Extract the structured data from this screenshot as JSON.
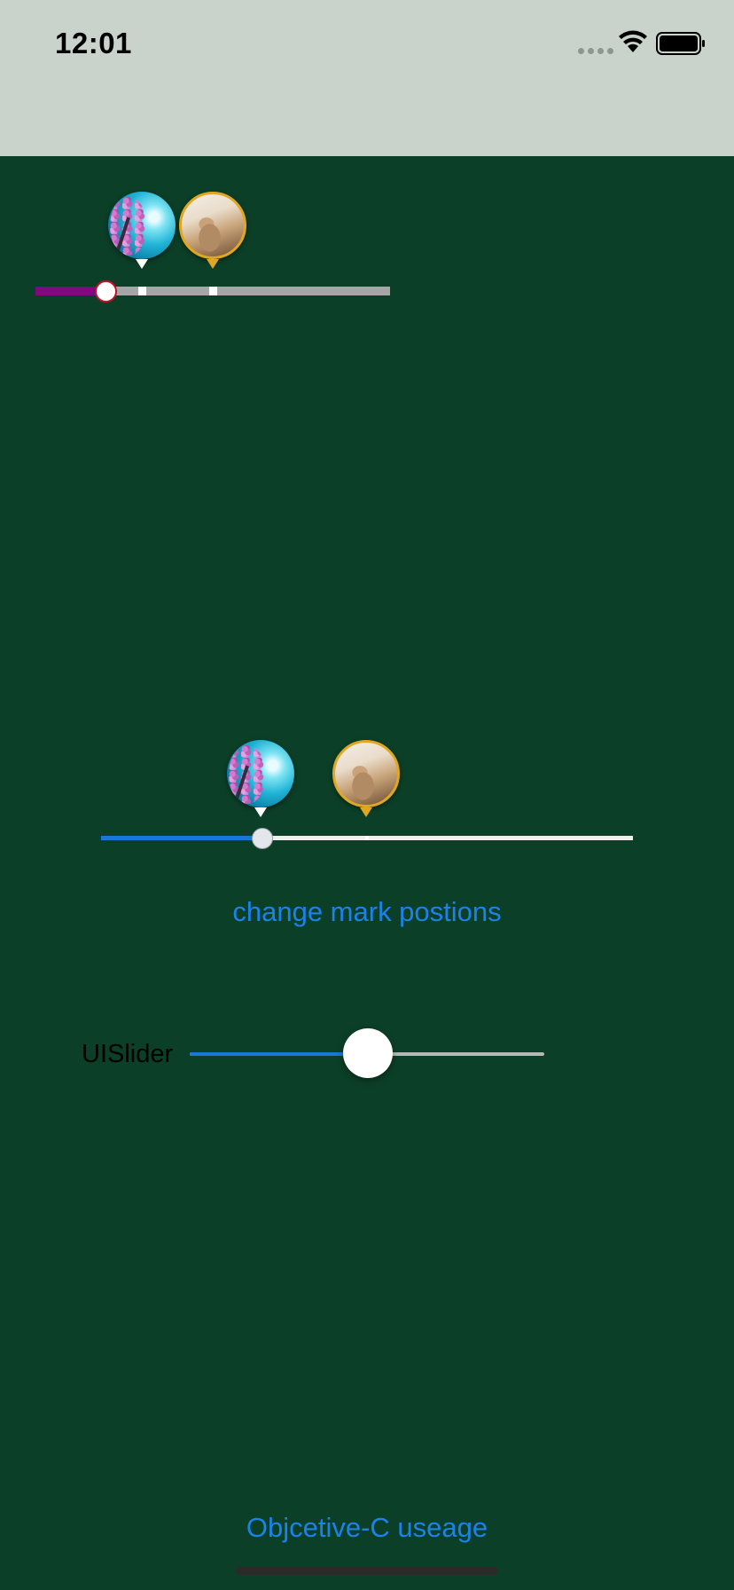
{
  "status_bar": {
    "time": "12:01",
    "icons": [
      "cellular-signal-icon",
      "wifi-icon",
      "battery-icon"
    ]
  },
  "slider_1": {
    "value": 0.2,
    "marks": [
      0.3,
      0.5
    ],
    "fill_color": "#7f0a7f",
    "track_color": "#a6a6a6",
    "thumb_border_color": "#c2122a",
    "mark_images": [
      "cherry-blossom-image",
      "rabbit-image"
    ]
  },
  "slider_2": {
    "value": 0.3,
    "marks": [
      0.3,
      0.5
    ],
    "fill_color": "#1a76d8",
    "track_color": "#eeeeee",
    "mark_images": [
      "cherry-blossom-image",
      "rabbit-image"
    ]
  },
  "change_marks_button": "change mark postions",
  "uislider": {
    "label": "UISlider",
    "value": 0.5,
    "fill_color": "#1a76d8",
    "track_color": "#b8b8b8"
  },
  "objc_button": "Objcetive-C useage"
}
